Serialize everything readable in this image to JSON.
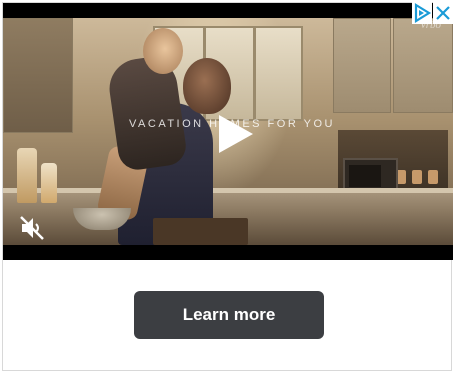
{
  "video": {
    "overlay_text": "Vacation Homes for You",
    "watermark": "Vrbo",
    "play_icon": "play-icon",
    "mute_icon": "speaker-muted-icon"
  },
  "ad": {
    "adchoices_icon": "adchoices-icon",
    "close_icon": "close-icon",
    "accent_color": "#1a9bd7"
  },
  "cta": {
    "label": "Learn more",
    "background": "#3c3e42"
  }
}
